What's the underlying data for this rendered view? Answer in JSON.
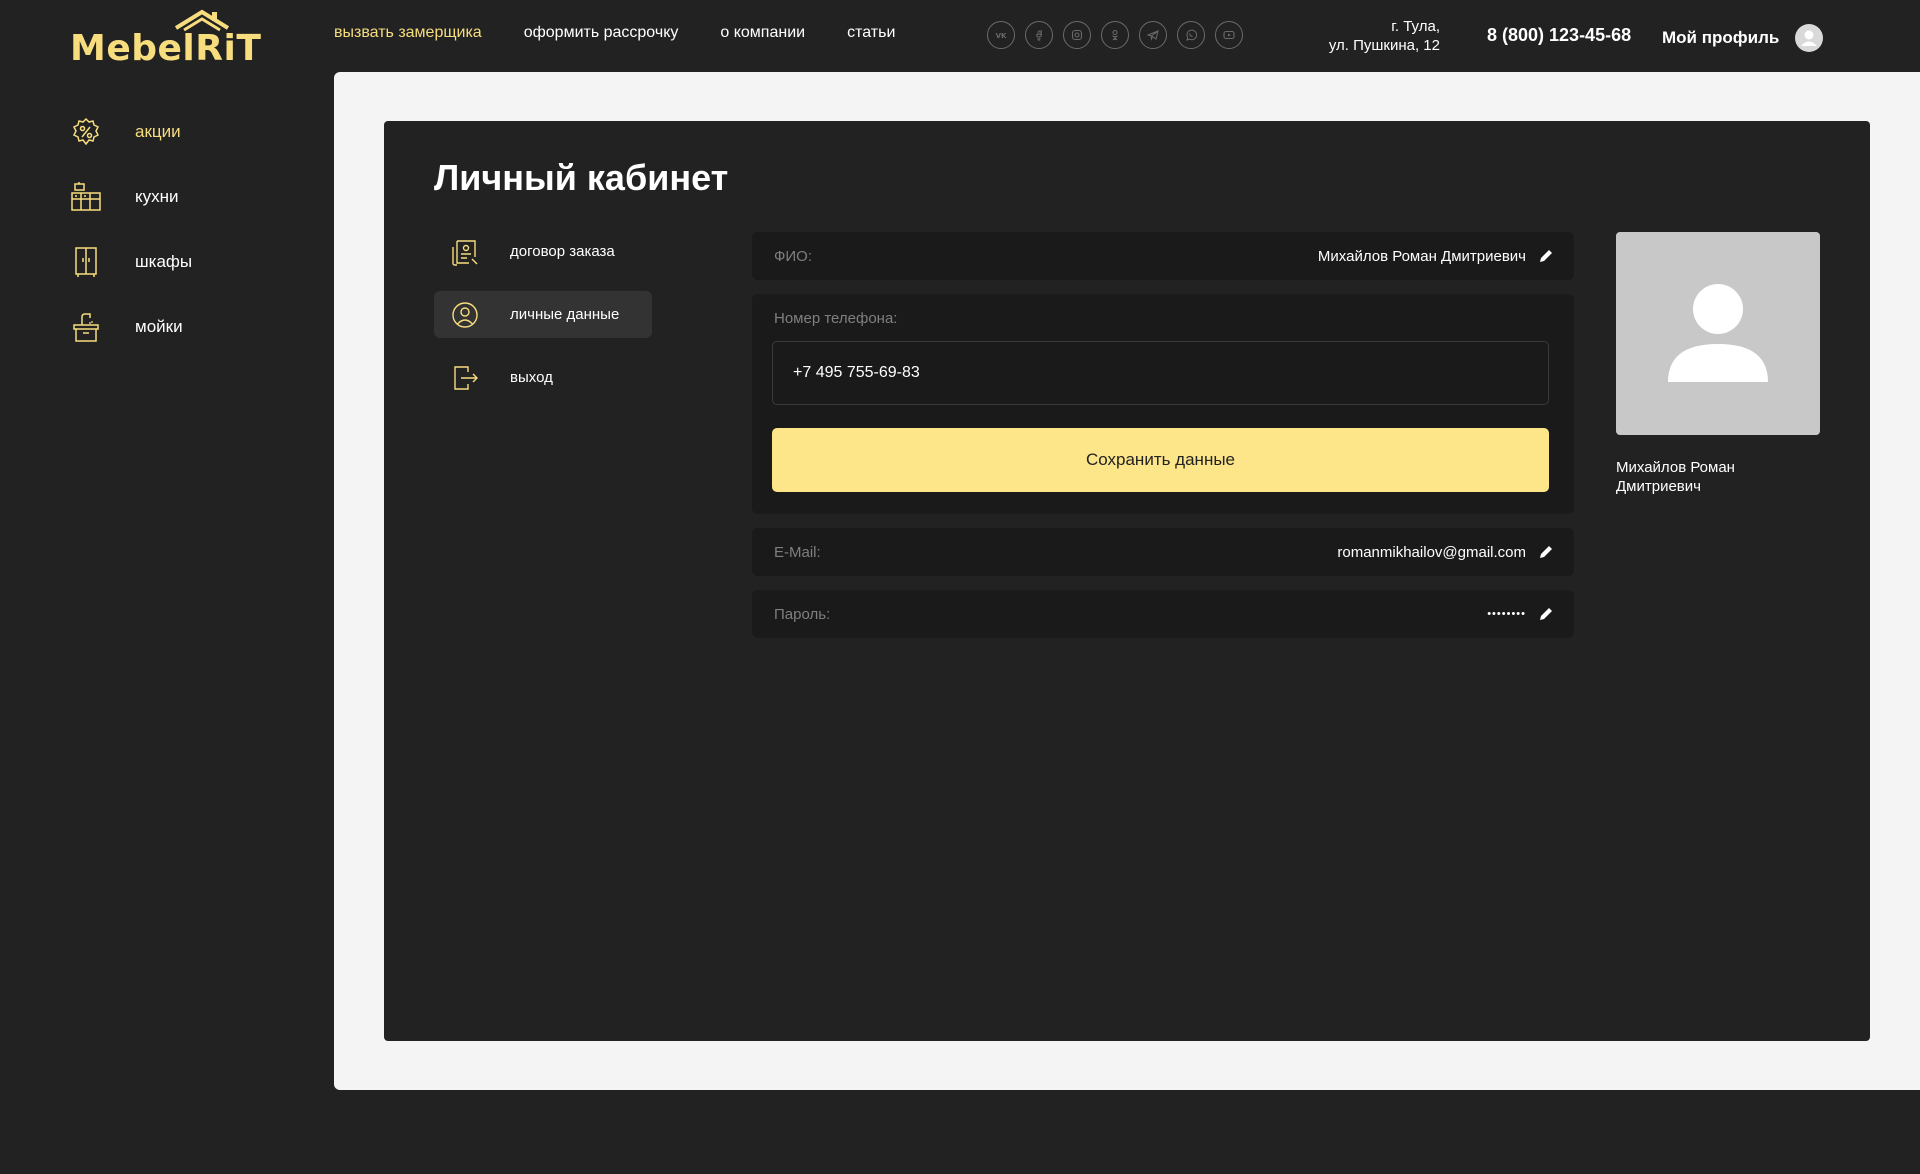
{
  "logo": {
    "text": "MebelRiT"
  },
  "colors": {
    "accent": "#f7dd7e",
    "button": "#fde58a",
    "background": "#222222",
    "page": "#f4f4f4"
  },
  "topnav": {
    "items": [
      {
        "label": "вызвать замерщика",
        "active": true
      },
      {
        "label": "оформить рассрочку"
      },
      {
        "label": "о компании"
      },
      {
        "label": "статьи"
      }
    ]
  },
  "socials": [
    "vk-icon",
    "facebook-icon",
    "instagram-icon",
    "odnoklassniki-icon",
    "telegram-icon",
    "whatsapp-icon",
    "youtube-icon"
  ],
  "header": {
    "address_line1": "г. Тула,",
    "address_line2": "ул. Пушкина, 12",
    "phone": "8 (800) 123-45-68",
    "profile_label": "Мой профиль"
  },
  "sidebar": {
    "items": [
      {
        "label": "акции",
        "icon": "discount-badge-icon",
        "active": true
      },
      {
        "label": "кухни",
        "icon": "kitchen-icon"
      },
      {
        "label": "шкафы",
        "icon": "wardrobe-icon"
      },
      {
        "label": "мойки",
        "icon": "sink-icon"
      }
    ]
  },
  "cabinet": {
    "title": "Личный кабинет",
    "menu": [
      {
        "label": "договор заказа",
        "icon": "contract-icon"
      },
      {
        "label": "личные данные",
        "icon": "user-circle-icon",
        "active": true
      },
      {
        "label": "выход",
        "icon": "logout-icon"
      }
    ],
    "fio": {
      "label": "ФИО:",
      "value": "Михайлов Роман Дмитриевич"
    },
    "phone": {
      "label": "Номер телефона:",
      "value": "+7 495 755-69-83"
    },
    "save_label": "Сохранить данные",
    "email": {
      "label": "E-Mail:",
      "value": "romanmikhailov@gmail.com"
    },
    "password": {
      "label": "Пароль:",
      "value": "••••••••"
    },
    "avatar_name": "Михайлов Роман Дмитриевич"
  }
}
